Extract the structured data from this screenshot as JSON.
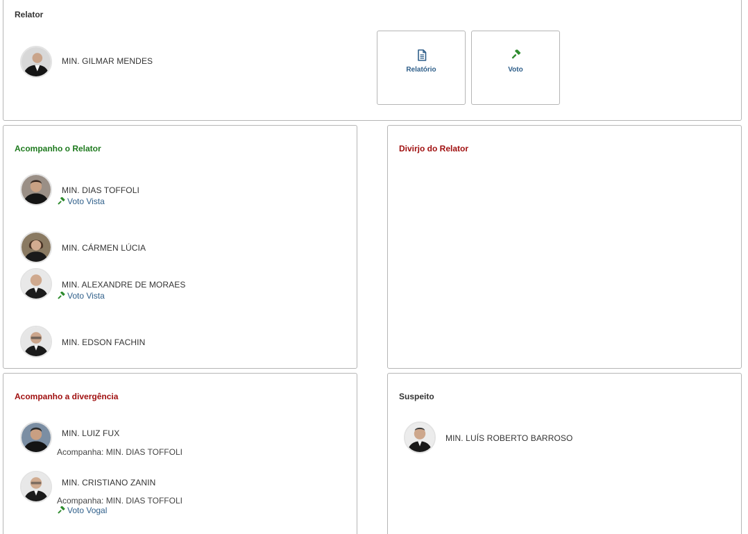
{
  "relator": {
    "title": "Relator",
    "minister": "MIN. GILMAR MENDES",
    "buttons": {
      "relatorio": "Relatório",
      "voto": "Voto"
    }
  },
  "acompanho_relator": {
    "title": "Acompanho o Relator",
    "ministers": [
      {
        "name": "MIN. DIAS TOFFOLI",
        "vote_link": "Voto Vista"
      },
      {
        "name": "MIN. CÁRMEN LÚCIA"
      },
      {
        "name": "MIN. ALEXANDRE DE MORAES",
        "vote_link": "Voto Vista"
      },
      {
        "name": "MIN. EDSON FACHIN"
      }
    ]
  },
  "divirjo_relator": {
    "title": "Divirjo do Relator"
  },
  "acompanho_divergencia": {
    "title": "Acompanho a divergência",
    "ministers": [
      {
        "name": "MIN. LUIZ FUX",
        "follows": "Acompanha: MIN. DIAS TOFFOLI"
      },
      {
        "name": "MIN. CRISTIANO ZANIN",
        "follows": "Acompanha: MIN. DIAS TOFFOLI",
        "vote_link": "Voto Vogal"
      }
    ]
  },
  "suspeito": {
    "title": "Suspeito",
    "minister": "MIN. LUÍS ROBERTO BARROSO"
  },
  "colors": {
    "green": "#1e7a1e",
    "red": "#a01010",
    "link": "#2f5f8a",
    "border": "#b5b5b5"
  },
  "icons": {
    "relatorio": "document-icon",
    "voto": "gavel-icon"
  }
}
